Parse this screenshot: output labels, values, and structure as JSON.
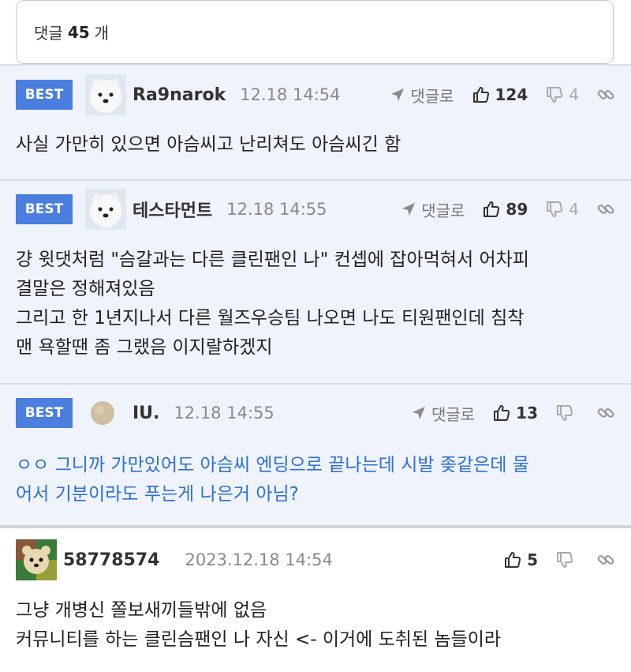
{
  "header": {
    "label_prefix": "댓글",
    "count": "45",
    "label_suffix": "개"
  },
  "comments": [
    {
      "badge": "BEST",
      "nickname": "Ra9narok",
      "time": "12.18 14:54",
      "reply_label": "댓글로",
      "likes": "124",
      "dislikes": "4",
      "text": "사실 가만히 있으면 아슴씨고 난리쳐도 아슴씨긴 함"
    },
    {
      "badge": "BEST",
      "nickname": "테스타먼트",
      "time": "12.18 14:55",
      "reply_label": "댓글로",
      "likes": "89",
      "dislikes": "4",
      "text": "걍 윗댓처럼 \"슴갈과는 다른 클린팬인 나\" 컨셉에 잡아먹혀서 어차피\n결말은 정해져있음\n그리고 한 1년지나서 다른 월즈우승팀 나오면 나도 티원팬인데 침착\n맨 욕할땐 좀 그랬음 이지랄하겠지"
    },
    {
      "badge": "BEST",
      "nickname": "IU.",
      "time": "12.18 14:55",
      "reply_label": "댓글로",
      "likes": "13",
      "dislikes": "",
      "text": "ㅇㅇ 그니까 가만있어도 아슴씨 엔딩으로 끝나는데 시발 좆같은데 물\n어서 기분이라도 푸는게 나은거 아님?"
    },
    {
      "badge": "",
      "nickname": "58778574",
      "time": "2023.12.18 14:54",
      "reply_label": "",
      "likes": "5",
      "dislikes": "",
      "text": "그냥 개병신 쫄보새끼들밖에 없음\n커뮤니티를 하는 클린슴팬인 나 자신 <- 이거에 도취된 놈들이라"
    }
  ],
  "icons": {
    "reply": "reply-arrow-icon",
    "like": "thumbs-up-icon",
    "dislike": "thumbs-down-icon",
    "share": "link-icon"
  },
  "colors": {
    "best_badge": "#4a7fe0",
    "best_bg": "#eef3fc",
    "blue_text": "#2f6fd6"
  }
}
